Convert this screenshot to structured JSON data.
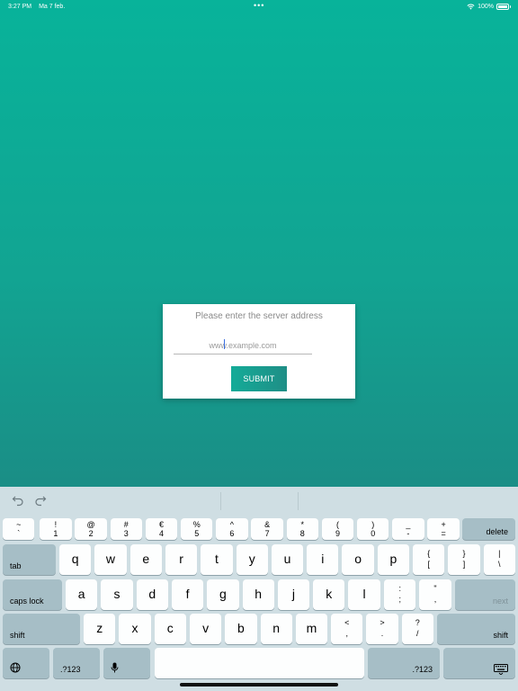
{
  "status": {
    "time": "3:27 PM",
    "date": "Ma 7 feb.",
    "dots": "•••",
    "battery": "100%",
    "battery_level": 1.0
  },
  "dialog": {
    "prompt": "Please enter the server address",
    "placeholder": "www.example.com",
    "submit_label": "SUBMIT"
  },
  "keyboard": {
    "toolbar": {
      "undo_icon": "undo-icon",
      "redo_icon": "redo-icon"
    },
    "row1": [
      {
        "top": "~",
        "bot": "`"
      },
      {
        "top": "!",
        "bot": "1"
      },
      {
        "top": "@",
        "bot": "2"
      },
      {
        "top": "#",
        "bot": "3"
      },
      {
        "top": "€",
        "bot": "4"
      },
      {
        "top": "%",
        "bot": "5"
      },
      {
        "top": "^",
        "bot": "6"
      },
      {
        "top": "&",
        "bot": "7"
      },
      {
        "top": "*",
        "bot": "8"
      },
      {
        "top": "(",
        "bot": "9"
      },
      {
        "top": ")",
        "bot": "0"
      },
      {
        "top": "_",
        "bot": "-"
      },
      {
        "top": "+",
        "bot": "="
      }
    ],
    "delete_label": "delete",
    "tab_label": "tab",
    "row2": [
      "q",
      "w",
      "e",
      "r",
      "t",
      "y",
      "u",
      "i",
      "o",
      "p"
    ],
    "row2_sym": [
      {
        "top": "{",
        "bot": "["
      },
      {
        "top": "}",
        "bot": "]"
      },
      {
        "top": "|",
        "bot": "\\"
      }
    ],
    "caps_label": "caps lock",
    "row3": [
      "a",
      "s",
      "d",
      "f",
      "g",
      "h",
      "j",
      "k",
      "l"
    ],
    "row3_sym": [
      {
        "top": ":",
        "bot": ";"
      },
      {
        "top": "\"",
        "bot": ","
      }
    ],
    "next_label": "next",
    "shift_label": "shift",
    "row4": [
      "z",
      "x",
      "c",
      "v",
      "b",
      "n",
      "m"
    ],
    "row4_sym": [
      {
        "top": "<",
        "bot": ","
      },
      {
        "top": ">",
        "bot": "."
      },
      {
        "top": "?",
        "bot": "/"
      }
    ],
    "num_label": ".?123",
    "globe_icon": "globe-icon",
    "mic_icon": "microphone-icon",
    "hide_icon": "keyboard-hide-icon"
  }
}
